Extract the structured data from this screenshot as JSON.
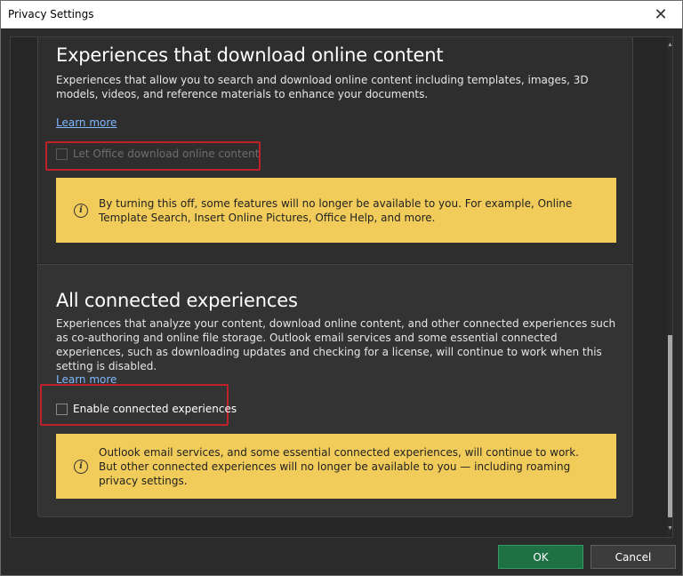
{
  "window": {
    "title": "Privacy Settings"
  },
  "section_download": {
    "heading": "Experiences that download online content",
    "description": "Experiences that allow you to search and download online content including templates, images, 3D models, videos, and reference materials to enhance your documents.",
    "learn_more": "Learn more",
    "checkbox_label": "Let Office download online content",
    "checked": false,
    "disabled": true,
    "warning": "By turning this off, some features will no longer be available to you. For example, Online Template Search, Insert Online Pictures, Office Help, and more."
  },
  "section_connected": {
    "heading": "All connected experiences",
    "description": "Experiences that analyze your content, download online content, and other connected experiences such as co-authoring and online file storage. Outlook email services and some essential connected experiences, such as downloading updates and checking for a license, will continue to work when this setting is disabled.",
    "learn_more": "Learn more",
    "checkbox_label": "Enable connected experiences",
    "checked": false,
    "warning": "Outlook email services, and some essential connected experiences, will continue to work. But other connected experiences will no longer be available to you — including roaming privacy settings."
  },
  "footer": {
    "ok_label": "OK",
    "cancel_label": "Cancel"
  },
  "icons": {
    "close": "close-icon",
    "info": "info-icon",
    "scroll_up": "chevron-up-icon",
    "scroll_down": "chevron-down-icon"
  },
  "colors": {
    "warning_bg": "#f2cc5a",
    "highlight": "#c0202a",
    "ok_button": "#1e7145",
    "link": "#7fb8ff"
  }
}
